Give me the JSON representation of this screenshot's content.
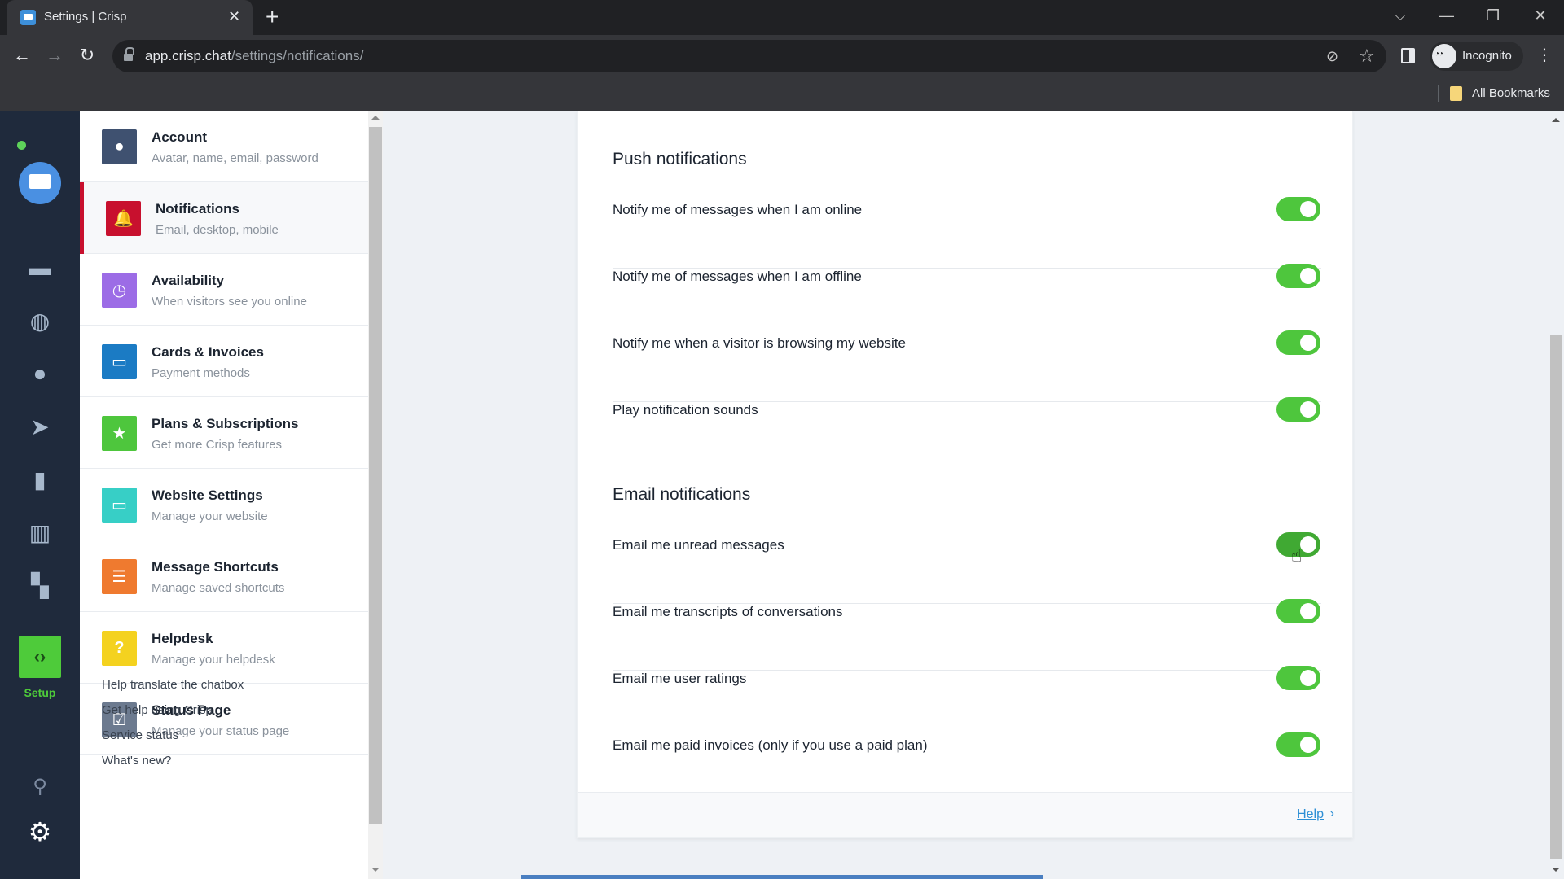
{
  "browser": {
    "tab_title": "Settings | Crisp",
    "tab_close": "✕",
    "new_tab": "+",
    "url_host": "app.crisp.chat",
    "url_path": "/settings/notifications/",
    "profile_label": "Incognito",
    "bookmarks_label": "All Bookmarks",
    "window_controls": {
      "tab_search": "⌵",
      "minimize": "—",
      "restore": "❐",
      "close": "✕"
    },
    "nav": {
      "back": "←",
      "forward": "→",
      "reload": "↻"
    }
  },
  "rail": {
    "items": [
      {
        "name": "chat-icon",
        "glyph": "▬"
      },
      {
        "name": "globe-icon",
        "glyph": "◍"
      },
      {
        "name": "user-icon",
        "glyph": "●"
      },
      {
        "name": "send-icon",
        "glyph": "➤"
      },
      {
        "name": "book-icon",
        "glyph": "▮"
      },
      {
        "name": "analytics-icon",
        "glyph": "▥"
      },
      {
        "name": "plugins-icon",
        "glyph": "▚"
      }
    ],
    "setup_glyph": "‹›",
    "setup_label": "Setup",
    "search_glyph": "⚲",
    "settings_glyph": "⚙"
  },
  "settings_list": {
    "active": "Notifications",
    "items": [
      {
        "title": "Account",
        "subtitle": "Avatar, name, email, password",
        "color": "#3f5170",
        "icon": "user-icon",
        "glyph": "●"
      },
      {
        "title": "Notifications",
        "subtitle": "Email, desktop, mobile",
        "color": "#c8102e",
        "icon": "bell-icon",
        "glyph": "🔔"
      },
      {
        "title": "Availability",
        "subtitle": "When visitors see you online",
        "color": "#9c6ce6",
        "icon": "clock-icon",
        "glyph": "◷"
      },
      {
        "title": "Cards & Invoices",
        "subtitle": "Payment methods",
        "color": "#1b7bc4",
        "icon": "card-icon",
        "glyph": "▭"
      },
      {
        "title": "Plans & Subscriptions",
        "subtitle": "Get more Crisp features",
        "color": "#4ec63d",
        "icon": "star-icon",
        "glyph": "★"
      },
      {
        "title": "Website Settings",
        "subtitle": "Manage your website",
        "color": "#37cfc6",
        "icon": "laptop-icon",
        "glyph": "▭"
      },
      {
        "title": "Message Shortcuts",
        "subtitle": "Manage saved shortcuts",
        "color": "#ef7a2f",
        "icon": "shortcut-icon",
        "glyph": "☰"
      },
      {
        "title": "Helpdesk",
        "subtitle": "Manage your helpdesk",
        "color": "#f4d21f",
        "icon": "helpdesk-icon",
        "glyph": "?"
      },
      {
        "title": "Status Page",
        "subtitle": "Manage your status page",
        "color": "#6c7a8f",
        "icon": "status-check-icon",
        "glyph": "☑"
      }
    ],
    "footer_links": [
      "Help translate the chatbox",
      "Get help using Crisp",
      "Service status",
      "What's new?"
    ]
  },
  "main": {
    "sections": [
      {
        "title": "Push notifications",
        "options": [
          {
            "label": "Notify me of messages when I am online",
            "enabled": true
          },
          {
            "label": "Notify me of messages when I am offline",
            "enabled": true
          },
          {
            "label": "Notify me when a visitor is browsing my website",
            "enabled": true
          },
          {
            "label": "Play notification sounds",
            "enabled": true
          }
        ]
      },
      {
        "title": "Email notifications",
        "options": [
          {
            "label": "Email me unread messages",
            "enabled": true
          },
          {
            "label": "Email me transcripts of conversations",
            "enabled": true
          },
          {
            "label": "Email me user ratings",
            "enabled": true
          },
          {
            "label": "Email me paid invoices (only if you use a paid plan)",
            "enabled": true
          }
        ]
      }
    ],
    "help_label": "Help",
    "help_chevron": "›"
  },
  "colors": {
    "toggle_on": "#4ec63d",
    "accent_active": "#c8102e",
    "rail_bg": "#1f2a3c",
    "setup_green": "#4ecb3a",
    "link": "#2d8fd5"
  }
}
